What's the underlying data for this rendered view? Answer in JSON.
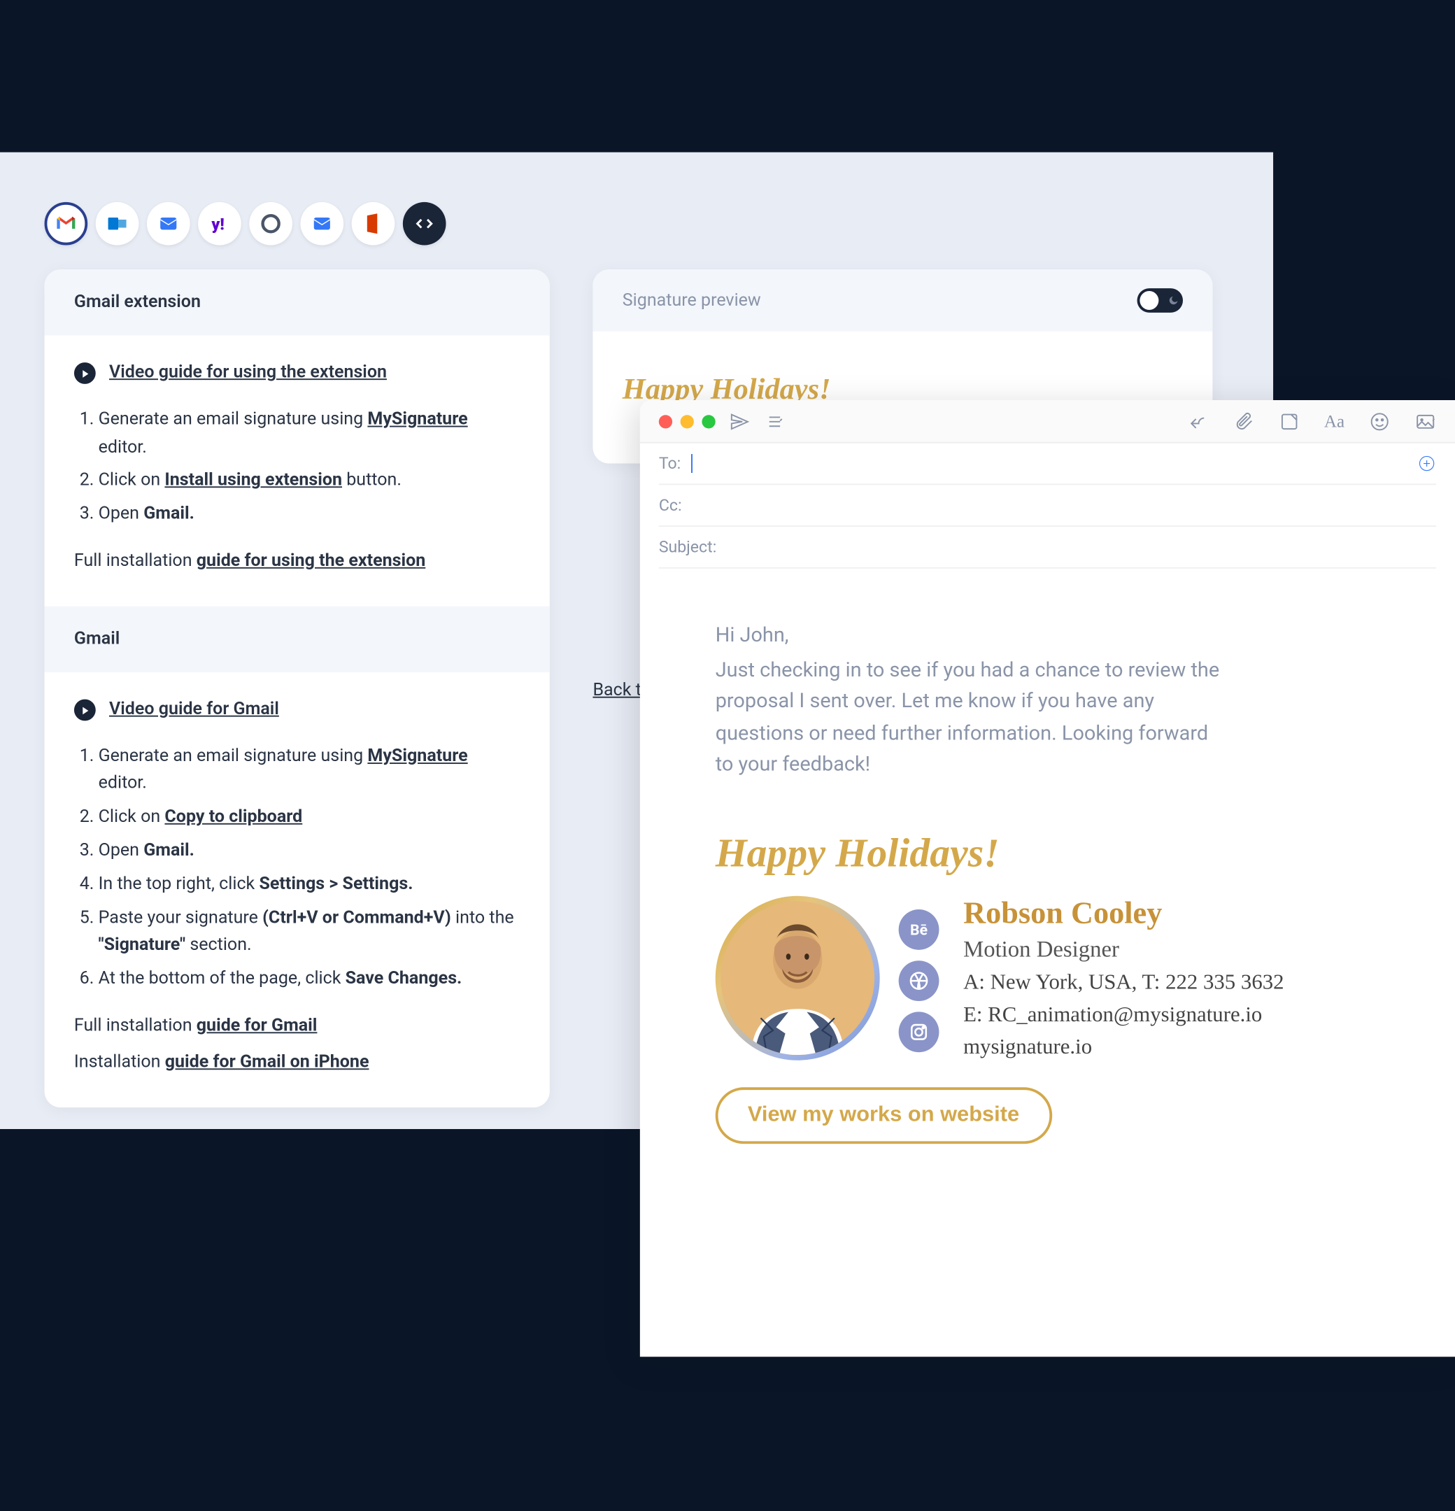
{
  "clients": {
    "icons": [
      "gmail",
      "outlook",
      "mail-blue",
      "yahoo",
      "circle",
      "mail-fill",
      "office",
      "code"
    ]
  },
  "left_card": {
    "header1": "Gmail extension",
    "video_link1": "Video guide for using the extension",
    "ext_steps": {
      "s1_a": "Generate an email signature using ",
      "s1_b": "MySignature",
      "s1_c": " editor.",
      "s2_a": "Click on ",
      "s2_b": "Install using extension",
      "s2_c": " button.",
      "s3_a": "Open ",
      "s3_b": "Gmail."
    },
    "full1_a": "Full installation ",
    "full1_b": "guide for using the extension",
    "header2": "Gmail",
    "video_link2": "Video guide for Gmail",
    "gmail_steps": {
      "s1_a": "Generate an email signature using ",
      "s1_b": "MySignature",
      "s1_c": " editor.",
      "s2_a": "Click on ",
      "s2_b": "Copy to clipboard",
      "s3_a": "Open ",
      "s3_b": "Gmail.",
      "s4_a": "In the top right, click ",
      "s4_b": "Settings > Settings.",
      "s5_a": "Paste your signature ",
      "s5_b": "(Ctrl+V or Command+V)",
      "s5_c": " into the ",
      "s5_d": "\"Signature\"",
      "s5_e": " section.",
      "s6_a": "At the bottom of the page, click ",
      "s6_b": "Save Changes."
    },
    "full2_a": "Full installation ",
    "full2_b": "guide for Gmail",
    "install_a": "Installation ",
    "install_b": "guide for Gmail on iPhone"
  },
  "preview": {
    "title": "Signature preview",
    "script": "Happy Holidays!"
  },
  "back_link": "Back to",
  "email": {
    "to_label": "To:",
    "cc_label": "Cc:",
    "subject_label": "Subject:",
    "greet": "Hi John,",
    "body": "Just checking in to see if you had a chance to review the proposal I sent over. Let me know if you have any questions or need further information. Looking forward to your feedback!",
    "aa": "Aa"
  },
  "signature": {
    "title": "Happy Holidays!",
    "name": "Robson Cooley",
    "role": "Motion Designer",
    "address_line": "A: New York, USA, T: 222 335 3632",
    "email_line": "E: RC_animation@mysignature.io",
    "site": "mysignature.io",
    "cta": "View my works on website",
    "socials": {
      "be": "Bē",
      "dr": "◉",
      "ig": "◎"
    }
  }
}
